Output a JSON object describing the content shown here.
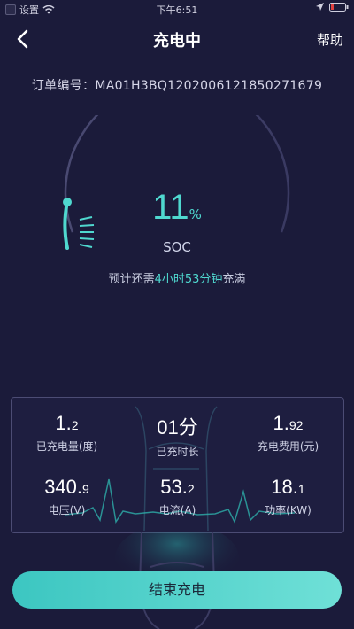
{
  "status_bar": {
    "left_label": "设置",
    "time": "下午6:51",
    "icons": [
      "wifi-icon",
      "location-icon",
      "battery-icon"
    ]
  },
  "nav": {
    "title": "充电中",
    "help": "帮助",
    "back_icon": "chevron-left-icon"
  },
  "order": {
    "label": "订单编号：",
    "number": "MA01H3BQ1202006121850271679"
  },
  "soc": {
    "value": "11",
    "unit": "%",
    "label": "SOC",
    "progress_fraction": 0.11
  },
  "eta": {
    "prefix": "预计还需",
    "time": "4小时53分钟",
    "suffix": "充满"
  },
  "stats": {
    "charged_amount": {
      "int": "1.",
      "dec": "2",
      "label": "已充电量(度)"
    },
    "duration": {
      "value": "01分",
      "label": "已充时长"
    },
    "fee": {
      "int": "1.",
      "dec": "92",
      "label": "充电费用(元)"
    },
    "voltage": {
      "int": "340.",
      "dec": "9",
      "label": "电压(V)"
    },
    "current": {
      "int": "53.",
      "dec": "2",
      "label": "电流(A)"
    },
    "power": {
      "int": "18.",
      "dec": "1",
      "label": "功率(KW)"
    }
  },
  "action": {
    "end_label": "结束充电"
  },
  "colors": {
    "accent": "#4fd8cf",
    "background": "#1b1b3a",
    "button_from": "#3cc6c1",
    "button_to": "#6fe0d7"
  }
}
